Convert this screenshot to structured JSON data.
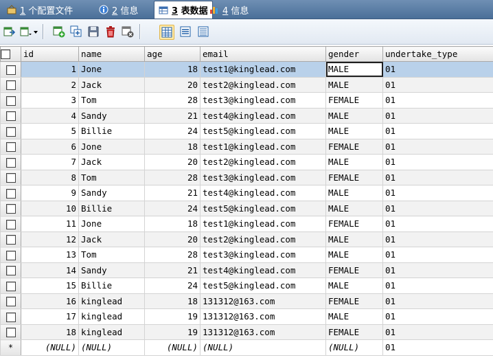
{
  "tabs": [
    {
      "num": "1",
      "label": " 个配置文件",
      "icon": "config-icon"
    },
    {
      "num": "2",
      "label": " 信息",
      "icon": "info-icon"
    },
    {
      "num": "3",
      "label": " 表数据",
      "icon": "table-icon"
    },
    {
      "num": "4",
      "label": " 信息",
      "icon": "chart-info-icon"
    }
  ],
  "toolbar": {
    "icons": [
      "export-icon",
      "import-dropdown-icon",
      "add-row-icon",
      "duplicate-row-icon",
      "save-icon",
      "delete-icon",
      "cancel-icon",
      "grid-view-icon",
      "form-view-icon",
      "text-view-icon"
    ]
  },
  "grid": {
    "columns": [
      "id",
      "name",
      "age",
      "email",
      "gender",
      "undertake_type"
    ],
    "rows": [
      [
        "1",
        "Jone",
        "18",
        "test1@kinglead.com",
        "MALE",
        "01"
      ],
      [
        "2",
        "Jack",
        "20",
        "test2@kinglead.com",
        "MALE",
        "01"
      ],
      [
        "3",
        "Tom",
        "28",
        "test3@kinglead.com",
        "FEMALE",
        "01"
      ],
      [
        "4",
        "Sandy",
        "21",
        "test4@kinglead.com",
        "MALE",
        "01"
      ],
      [
        "5",
        "Billie",
        "24",
        "test5@kinglead.com",
        "MALE",
        "01"
      ],
      [
        "6",
        "Jone",
        "18",
        "test1@kinglead.com",
        "FEMALE",
        "01"
      ],
      [
        "7",
        "Jack",
        "20",
        "test2@kinglead.com",
        "MALE",
        "01"
      ],
      [
        "8",
        "Tom",
        "28",
        "test3@kinglead.com",
        "FEMALE",
        "01"
      ],
      [
        "9",
        "Sandy",
        "21",
        "test4@kinglead.com",
        "MALE",
        "01"
      ],
      [
        "10",
        "Billie",
        "24",
        "test5@kinglead.com",
        "MALE",
        "01"
      ],
      [
        "11",
        "Jone",
        "18",
        "test1@kinglead.com",
        "FEMALE",
        "01"
      ],
      [
        "12",
        "Jack",
        "20",
        "test2@kinglead.com",
        "MALE",
        "01"
      ],
      [
        "13",
        "Tom",
        "28",
        "test3@kinglead.com",
        "MALE",
        "01"
      ],
      [
        "14",
        "Sandy",
        "21",
        "test4@kinglead.com",
        "FEMALE",
        "01"
      ],
      [
        "15",
        "Billie",
        "24",
        "test5@kinglead.com",
        "MALE",
        "01"
      ],
      [
        "16",
        "kinglead",
        "18",
        "131312@163.com",
        "FEMALE",
        "01"
      ],
      [
        "17",
        "kinglead",
        "19",
        "131312@163.com",
        "MALE",
        "01"
      ],
      [
        "18",
        "kinglead",
        "19",
        "131312@163.com",
        "FEMALE",
        "01"
      ]
    ],
    "new_row": {
      "marker": "*",
      "values": [
        "(NULL)",
        "(NULL)",
        "(NULL)",
        "(NULL)",
        "(NULL)",
        "01"
      ]
    },
    "selected_row": 0,
    "focused_column": 4
  },
  "colors": {
    "tabbar": "#4a6f99",
    "selected_row": "#b9d1ea",
    "alt_row": "#f2f2f2"
  }
}
